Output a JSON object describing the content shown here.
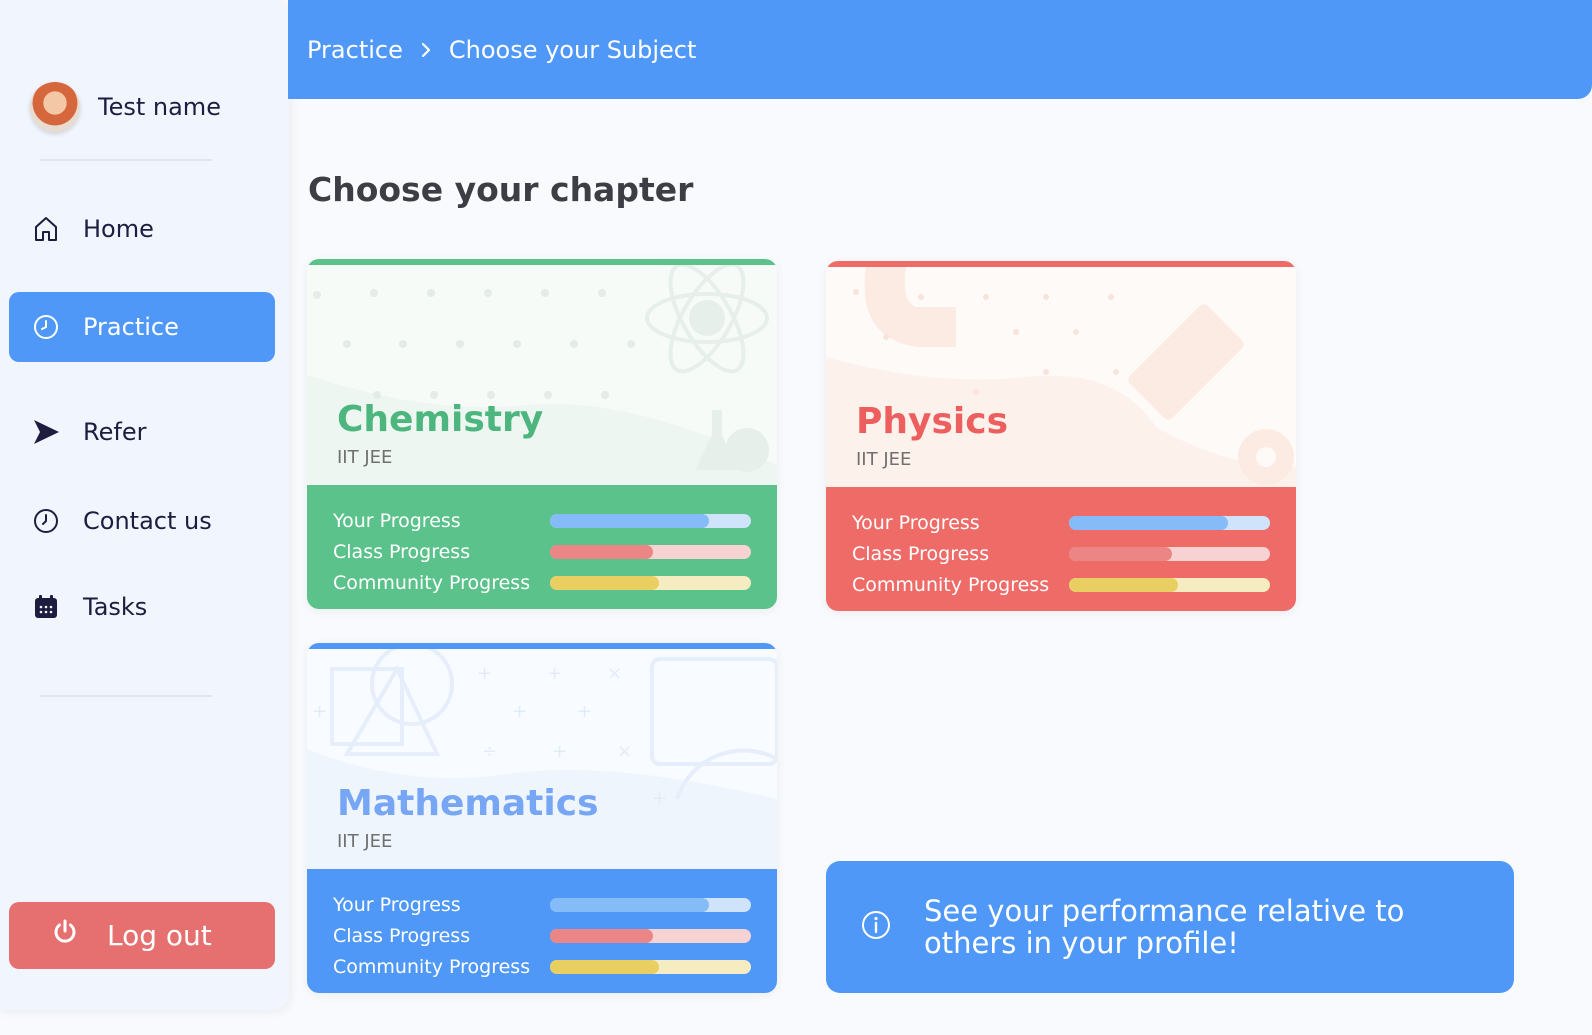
{
  "user": {
    "name": "Test name"
  },
  "sidebar": {
    "items": [
      {
        "label": "Home",
        "icon": "home-icon"
      },
      {
        "label": "Practice",
        "icon": "clock-icon",
        "active": true
      },
      {
        "label": "Refer",
        "icon": "send-icon"
      },
      {
        "label": "Contact us",
        "icon": "clock-icon"
      },
      {
        "label": "Tasks",
        "icon": "calendar-icon"
      }
    ],
    "logout_label": "Log out"
  },
  "breadcrumb": {
    "parent": "Practice",
    "current": "Choose your Subject"
  },
  "page_title": "Choose your chapter",
  "progress_labels": [
    "Your Progress",
    "Class Progress",
    "Community Progress"
  ],
  "cards": [
    {
      "name": "Chemistry",
      "sub": "IIT JEE",
      "accent": "#5cc28c",
      "progress": {
        "your": 0.79,
        "class": 0.51,
        "community": 0.54
      }
    },
    {
      "name": "Physics",
      "sub": "IIT JEE",
      "accent": "#ee6b67",
      "progress": {
        "your": 0.79,
        "class": 0.51,
        "community": 0.54
      }
    },
    {
      "name": "Mathematics",
      "sub": "IIT JEE",
      "accent": "#4f98f7",
      "progress": {
        "your": 0.79,
        "class": 0.51,
        "community": 0.54
      }
    }
  ],
  "info": {
    "text": "See your performance relative to others in your profile!"
  },
  "colors": {
    "primary": "#4f98f7",
    "danger": "#e6706f",
    "success": "#5cc28c"
  }
}
